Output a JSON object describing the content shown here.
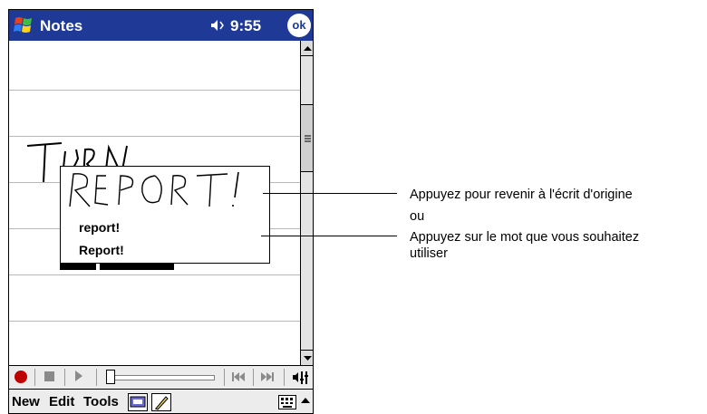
{
  "titlebar": {
    "app_title": "Notes",
    "time": "9:55",
    "ok_label": "ok"
  },
  "popup": {
    "items": [
      "report!",
      "Report!"
    ]
  },
  "menu": {
    "new": "New",
    "edit": "Edit",
    "tools": "Tools"
  },
  "callouts": {
    "top": "Appuyez pour revenir à l'écrit d'origine",
    "middle": "ou",
    "bottom_line1": "Appuyez sur le mot que vous souhaitez",
    "bottom_line2": "utiliser"
  },
  "colors": {
    "title_bar": "#1e3a96",
    "record": "#c00000"
  }
}
